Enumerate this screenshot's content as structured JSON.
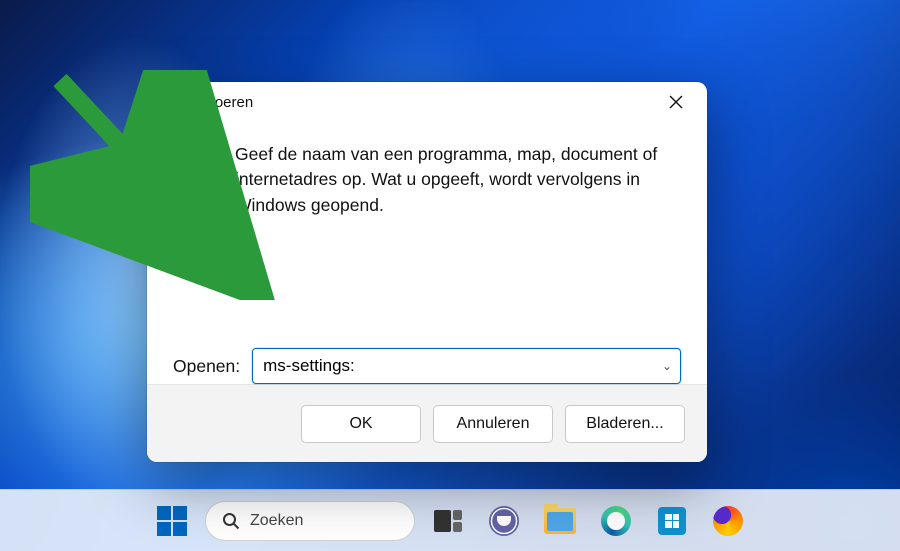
{
  "dialog": {
    "title": "Uitvoeren",
    "description": "Geef de naam van een programma, map, document of internetadres op. Wat u opgeeft, wordt vervolgens in Windows geopend.",
    "open_label": "Openen:",
    "input_value": "ms-settings:",
    "buttons": {
      "ok": "OK",
      "cancel": "Annuleren",
      "browse": "Bladeren..."
    }
  },
  "taskbar": {
    "search_placeholder": "Zoeken"
  }
}
